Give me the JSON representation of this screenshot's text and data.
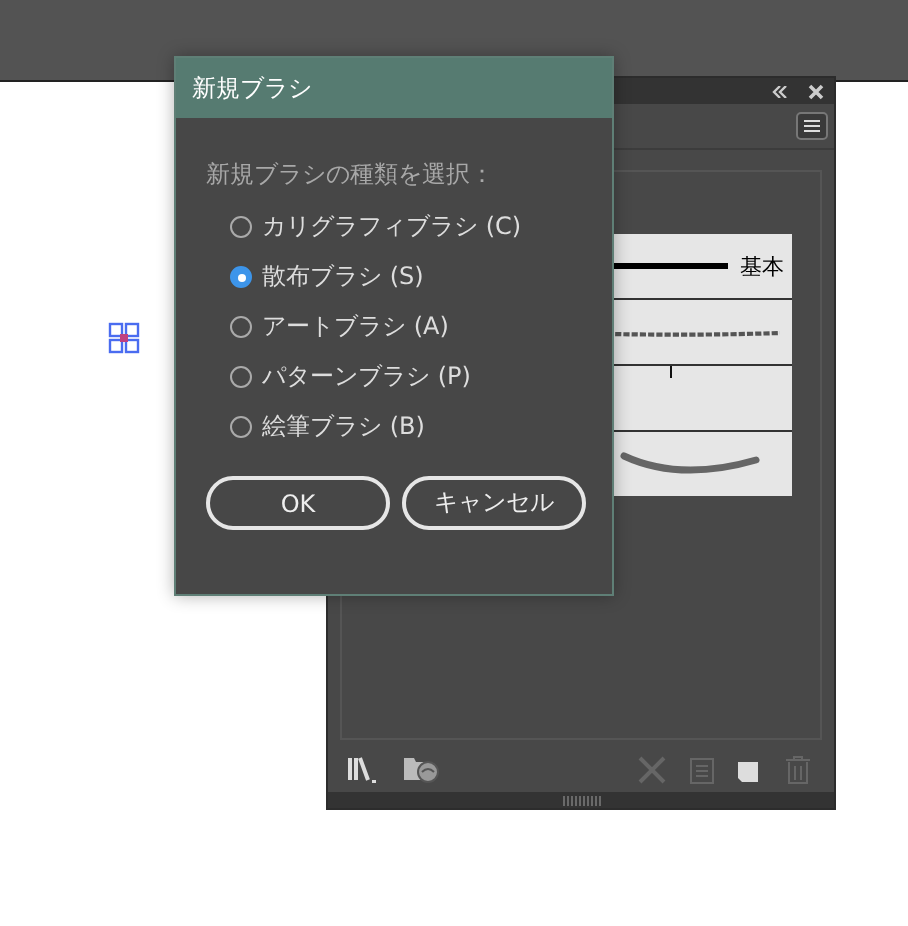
{
  "panel": {
    "brushes": [
      {
        "kind": "basic",
        "label": "基本"
      },
      {
        "kind": "scatter"
      },
      {
        "kind": "pattern"
      },
      {
        "kind": "art"
      }
    ]
  },
  "dialog": {
    "title": "新規ブラシ",
    "prompt": "新規ブラシの種類を選択：",
    "options": [
      {
        "label": "カリグラフィブラシ (C)",
        "selected": false
      },
      {
        "label": "散布ブラシ (S)",
        "selected": true
      },
      {
        "label": "アートブラシ (A)",
        "selected": false
      },
      {
        "label": "パターンブラシ (P)",
        "selected": false
      },
      {
        "label": "絵筆ブラシ (B)",
        "selected": false
      }
    ],
    "buttons": [
      "OK",
      "キャンセル"
    ]
  }
}
